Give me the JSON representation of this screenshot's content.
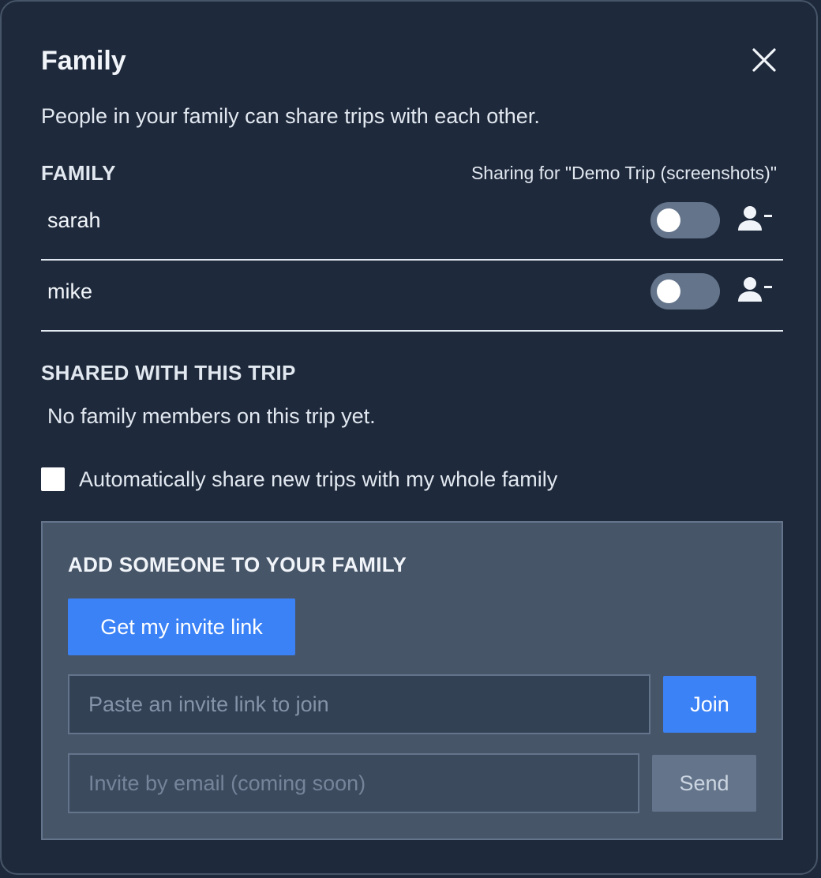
{
  "dialog": {
    "title": "Family",
    "subtitle": "People in your family can share trips with each other.",
    "close_icon": "close-icon"
  },
  "family": {
    "heading": "FAMILY",
    "sharing_for": "Sharing for \"Demo Trip (screenshots)\"",
    "members": [
      {
        "name": "sarah",
        "sharing": false,
        "remove_icon": "user-minus-icon"
      },
      {
        "name": "mike",
        "sharing": false,
        "remove_icon": "user-minus-icon"
      }
    ]
  },
  "shared": {
    "heading": "SHARED WITH THIS TRIP",
    "empty_text": "No family members on this trip yet."
  },
  "auto_share": {
    "label": "Automatically share new trips with my whole family",
    "checked": false
  },
  "add": {
    "heading": "ADD SOMEONE TO YOUR FAMILY",
    "invite_link_button": "Get my invite link",
    "join_input": {
      "value": "",
      "placeholder": "Paste an invite link to join"
    },
    "join_button": "Join",
    "email_input": {
      "value": "",
      "placeholder": "Invite by email (coming soon)"
    },
    "send_button": "Send"
  },
  "colors": {
    "background": "#1e293b",
    "panel": "#475569",
    "accent": "#3b82f6",
    "toggle_off": "#64748b"
  }
}
